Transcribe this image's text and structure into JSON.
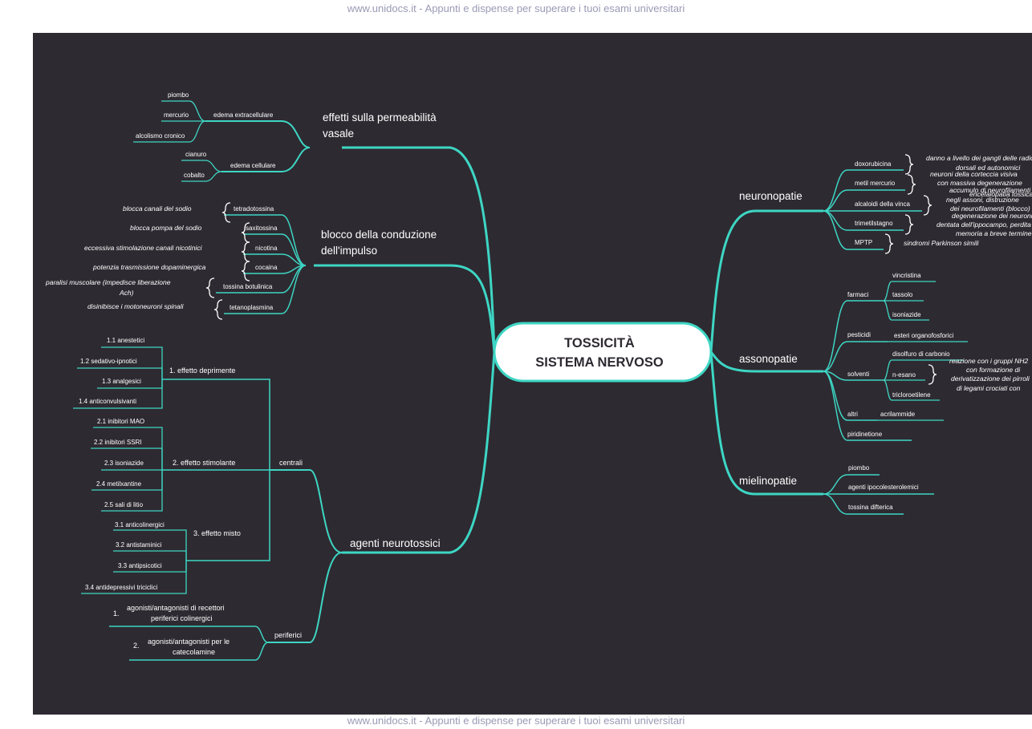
{
  "watermark": {
    "top": "www.unidocs.it - Appunti e dispense per superare i tuoi esami universitari",
    "bottom": "www.unidocs.it - Appunti e dispense per superare i tuoi esami universitari",
    "side": "www.unidocs.it - Appunti e dispense per superare i tuoi esami universitari"
  },
  "colors": {
    "background": "#2e2a31",
    "branch": "#3dd6c4",
    "text": "#ffffff"
  },
  "center": {
    "line1": "TOSSICITÀ",
    "line2": "SISTEMA NERVOSO"
  },
  "left": {
    "permeabilita": {
      "line1": "effetti sulla permeabilità",
      "line2": "vasale",
      "extracellulare": {
        "label": "edema extracellulare",
        "items": [
          "piombo",
          "mercurio",
          "alcolismo cronico"
        ]
      },
      "cellulare": {
        "label": "edema cellulare",
        "items": [
          "cianuro",
          "cobalto"
        ]
      }
    },
    "conduzione": {
      "line1": "blocco della conduzione",
      "line2": "dell'impulso",
      "items": [
        {
          "label": "tetradotossina",
          "note": "blocca canali del sodio"
        },
        {
          "label": "saxitossina",
          "note": "blocca pompa del sodio"
        },
        {
          "label": "nicotina",
          "note": "eccessiva stimolazione canali nicotinici"
        },
        {
          "label": "cocaina",
          "note": "potenzia trasmissione dopaminergica"
        },
        {
          "label": "tossina botulinica",
          "note1": "paralisi muscolare (impedisce liberazione",
          "note2": "Ach)"
        },
        {
          "label": "tetanoplasmina",
          "note": "disinibisce i motoneuroni spinali"
        }
      ]
    },
    "neurotossici": {
      "label": "agenti neurotossici",
      "centrali": {
        "label": "centrali",
        "deprimente": {
          "label": "1.  effetto deprimente",
          "items": [
            "1.1   anestetici",
            "1.2   sedativo-ipnotici",
            "1.3   analgesici",
            "1.4   anticonvulsivanti"
          ]
        },
        "stimolante": {
          "label": "2.  effetto stimolante",
          "items": [
            "2.1   inibitori MAO",
            "2.2   inibitori SSRI",
            "2.3   isoniazide",
            "2.4   metilxantine",
            "2.5   sali di litio"
          ]
        },
        "misto": {
          "label": "3.  effetto misto",
          "items": [
            "3.1   anticolinergici",
            "3.2   antistaminici",
            "3.3   antipsicotici",
            "3.4   antidepressivi triciclici"
          ]
        }
      },
      "periferici": {
        "label": "periferici",
        "items": [
          {
            "num": "1.",
            "line1": "agonisti/antagonisti di recettori",
            "line2": "periferici colinergici"
          },
          {
            "num": "2.",
            "line1": "agonisti/antagonisti per le",
            "line2": "catecolamine"
          }
        ]
      }
    }
  },
  "right": {
    "neuronopatie": {
      "label": "neuronopatie",
      "items": [
        {
          "label": "doxorubicina",
          "notes": [
            "danno a livello dei gangli delle radici",
            "dorsali ed autonomici"
          ]
        },
        {
          "label": "metil mercurio",
          "notes": [
            "neuroni della corteccia visiva",
            "con massiva degenerazione"
          ]
        },
        {
          "label": "alcaloidi della vinca",
          "notes": [
            "accumulo di neurofilamenti",
            "encefalopatia tossica",
            "negli assoni, distruzione",
            "dei neurofilamenti (blocco)"
          ]
        },
        {
          "label": "trimetilstagno",
          "notes": [
            "degenerazione dei neuroni granulari",
            "dentata dell'ippocampo, perdita della",
            "memoria a breve termine"
          ]
        },
        {
          "label": "MPTP",
          "notes": [
            "sindromi Parkinson simili"
          ]
        }
      ]
    },
    "assonopatie": {
      "label": "assonopatie",
      "farmaci": {
        "label": "farmaci",
        "items": [
          "vincristina",
          "tassolo",
          "isoniazide"
        ]
      },
      "pesticidi": {
        "label": "pesticidi",
        "items": [
          "esteri organofosforici"
        ]
      },
      "solventi": {
        "label": "solventi",
        "items": [
          "disolfuro di carbonio",
          "n-esano",
          "tricloroetilene"
        ],
        "notes": [
          "reazione con i gruppi NH2",
          "con formazione di",
          "derivatizzazione dei pirroli",
          "di legami crociati con"
        ]
      },
      "altri": {
        "label": "altri",
        "items": [
          "acrilammide"
        ]
      },
      "piridinetione": "piridinetione"
    },
    "mielinopatie": {
      "label": "mielinopatie",
      "items": [
        "piombo",
        "agenti ipocolesterolemici",
        "tossina difterica"
      ]
    }
  }
}
